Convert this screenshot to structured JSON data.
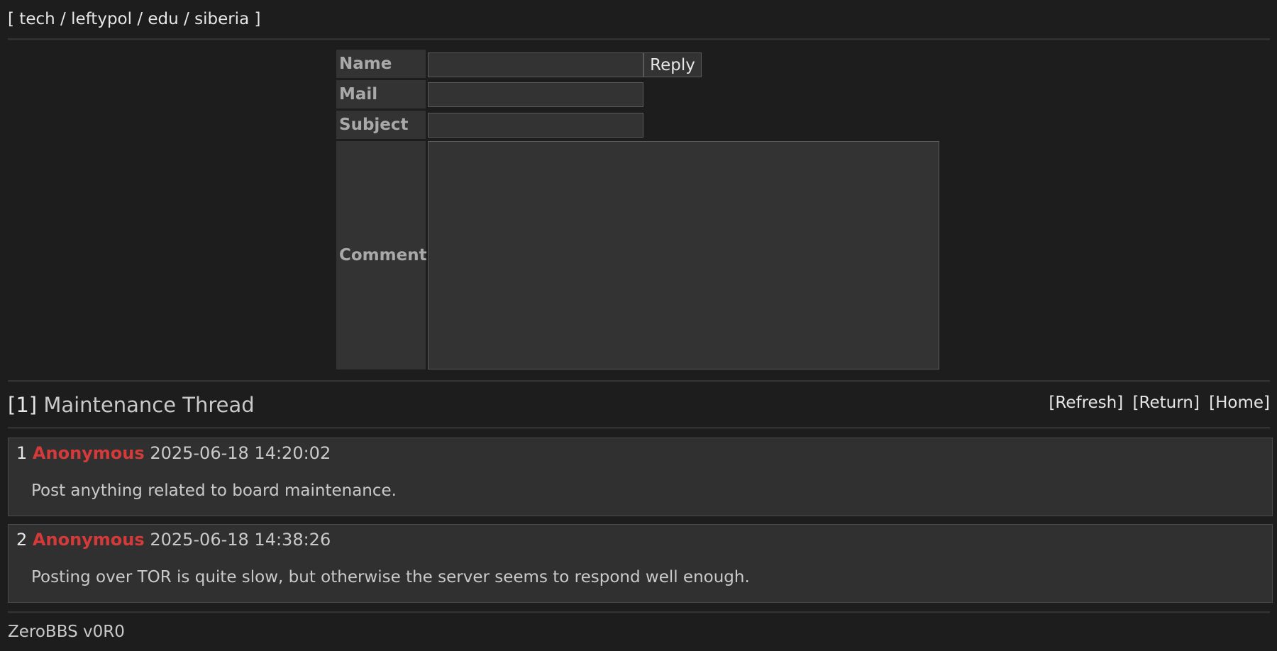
{
  "nav": {
    "open": "[",
    "close": "]",
    "separator": "/",
    "boards": [
      "tech",
      "leftypol",
      "edu",
      "siberia"
    ]
  },
  "form": {
    "name_label": "Name",
    "mail_label": "Mail",
    "subject_label": "Subject",
    "comment_label": "Comment",
    "name_value": "",
    "mail_value": "",
    "subject_value": "",
    "comment_value": "",
    "reply_label": "Reply"
  },
  "thread": {
    "number": "[1]",
    "title": "Maintenance Thread",
    "actions": {
      "refresh": "[Refresh]",
      "return": "[Return]",
      "home": "[Home]"
    }
  },
  "posts": [
    {
      "number": "1",
      "author": "Anonymous",
      "date": "2025-06-18 14:20:02",
      "body": "Post anything related to board maintenance."
    },
    {
      "number": "2",
      "author": "Anonymous",
      "date": "2025-06-18 14:38:26",
      "body": "Posting over TOR is quite slow, but otherwise the server seems to respond well enough."
    }
  ],
  "footer": {
    "version": "ZeroBBS v0R0"
  },
  "colors": {
    "background": "#1d1d1d",
    "panel": "#333333",
    "author_name": "#d43a3a",
    "text": "#c9c9c9"
  }
}
